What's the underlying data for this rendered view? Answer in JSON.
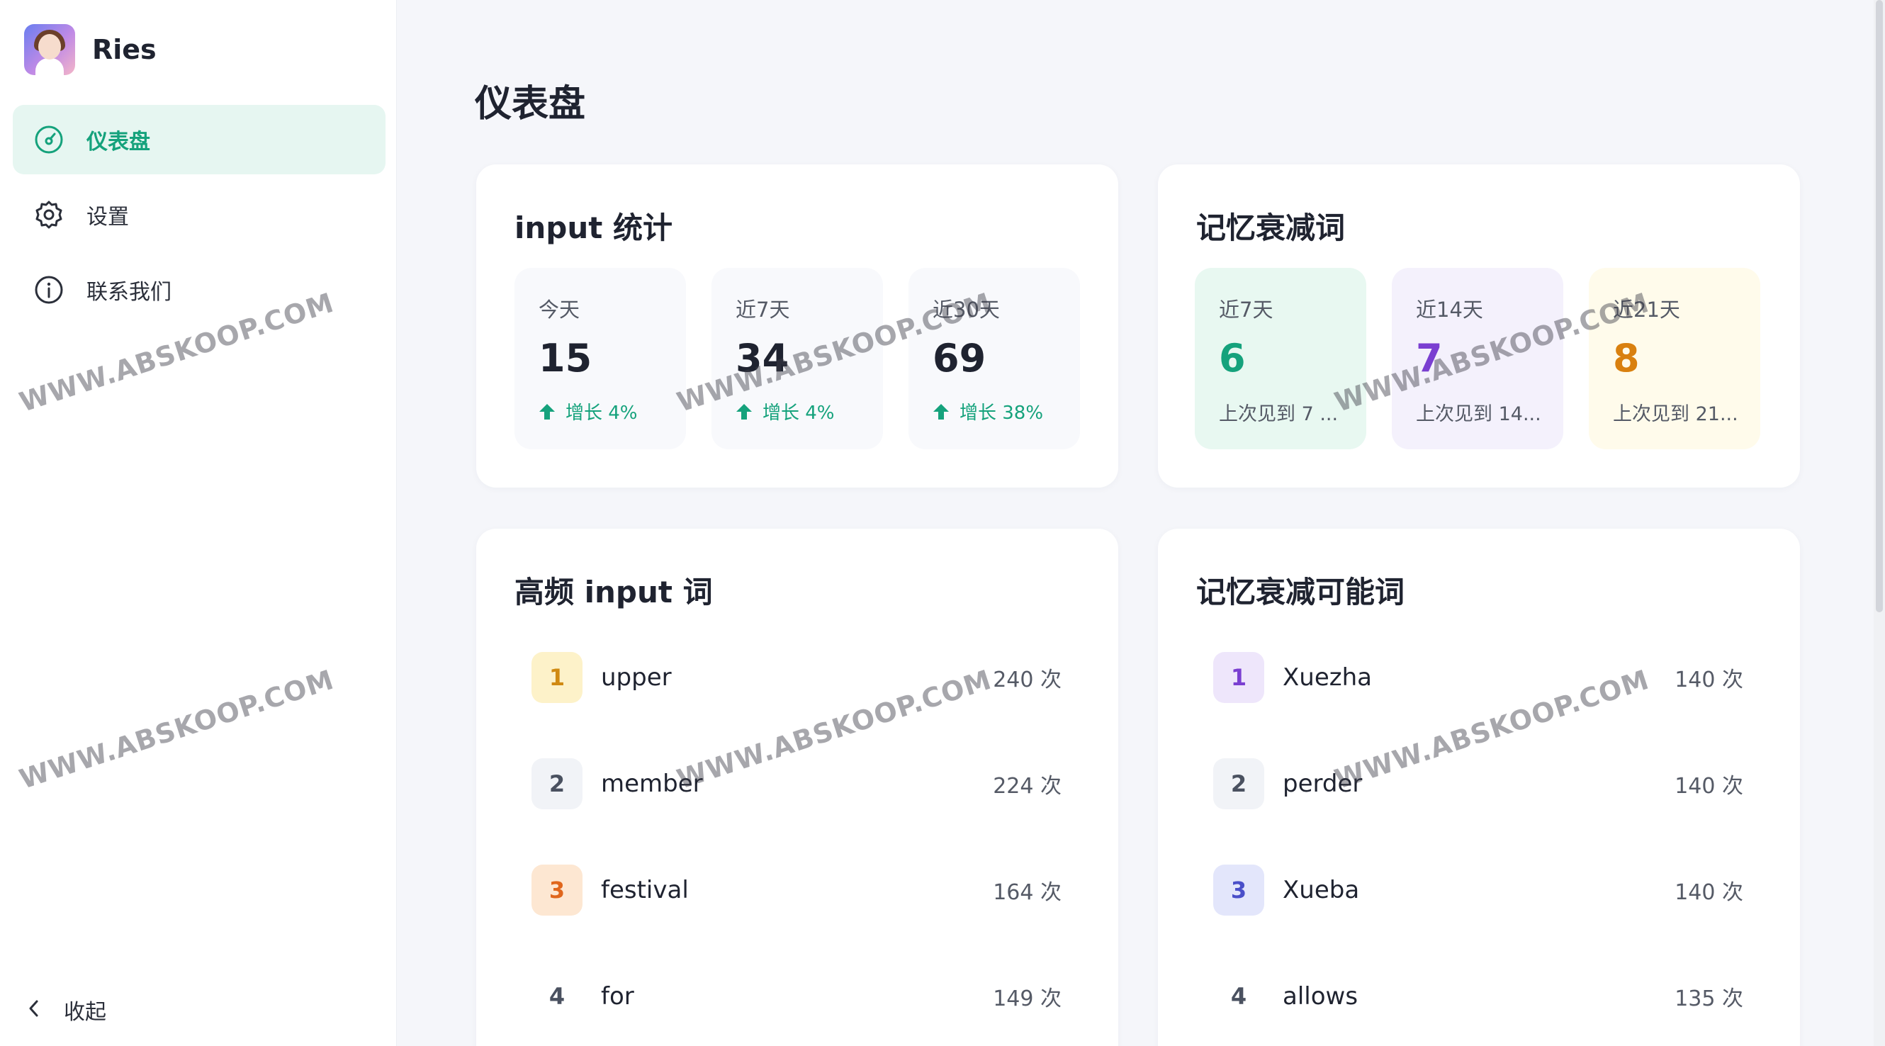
{
  "app": {
    "name": "Ries"
  },
  "sidebar": {
    "items": [
      {
        "label": "仪表盘",
        "icon": "dashboard-gauge-icon",
        "active": true
      },
      {
        "label": "设置",
        "icon": "gear-icon",
        "active": false
      },
      {
        "label": "联系我们",
        "icon": "info-circle-icon",
        "active": false
      }
    ],
    "collapse_label": "收起"
  },
  "page": {
    "title": "仪表盘"
  },
  "input_stats": {
    "title": "input 统计",
    "cards": [
      {
        "label": "今天",
        "value": "15",
        "trend": "增长 4%"
      },
      {
        "label": "近7天",
        "value": "34",
        "trend": "增长 4%"
      },
      {
        "label": "近30天",
        "value": "69",
        "trend": "增长 38%"
      }
    ]
  },
  "decay": {
    "title": "记忆衰减词",
    "cards": [
      {
        "label": "近7天",
        "value": "6",
        "note": "上次见到 7 ...",
        "color": "#15a27c",
        "bg": "#e8f8f1"
      },
      {
        "label": "近14天",
        "value": "7",
        "note": "上次见到 14...",
        "color": "#7a3fd1",
        "bg": "#f4f1fc"
      },
      {
        "label": "近21天",
        "value": "8",
        "note": "上次见到 21...",
        "color": "#d9800f",
        "bg": "#fffbeb"
      }
    ]
  },
  "top_words": {
    "title": "高频 input 词",
    "rows": [
      {
        "rank": "1",
        "word": "upper",
        "count": "240 次",
        "badge_bg": "#fdf2c9",
        "badge_color": "#d08a12"
      },
      {
        "rank": "2",
        "word": "member",
        "count": "224 次",
        "badge_bg": "#f1f3f7",
        "badge_color": "#4a5160"
      },
      {
        "rank": "3",
        "word": "festival",
        "count": "164 次",
        "badge_bg": "#fde7d2",
        "badge_color": "#e0661c"
      },
      {
        "rank": "4",
        "word": "for",
        "count": "149 次",
        "badge_bg": "#ffffff",
        "badge_color": "#4a5160"
      }
    ]
  },
  "decay_words": {
    "title": "记忆衰减可能词",
    "rows": [
      {
        "rank": "1",
        "word": "Xuezha",
        "count": "140 次",
        "badge_bg": "#eee6fb",
        "badge_color": "#7a3fd1"
      },
      {
        "rank": "2",
        "word": "perder",
        "count": "140 次",
        "badge_bg": "#f1f3f7",
        "badge_color": "#4a5160"
      },
      {
        "rank": "3",
        "word": "Xueba",
        "count": "140 次",
        "badge_bg": "#e3e6fb",
        "badge_color": "#4a4fc9"
      },
      {
        "rank": "4",
        "word": "allows",
        "count": "135 次",
        "badge_bg": "#ffffff",
        "badge_color": "#4a5160"
      }
    ]
  },
  "watermark": "WWW.ABSKOOP.COM"
}
